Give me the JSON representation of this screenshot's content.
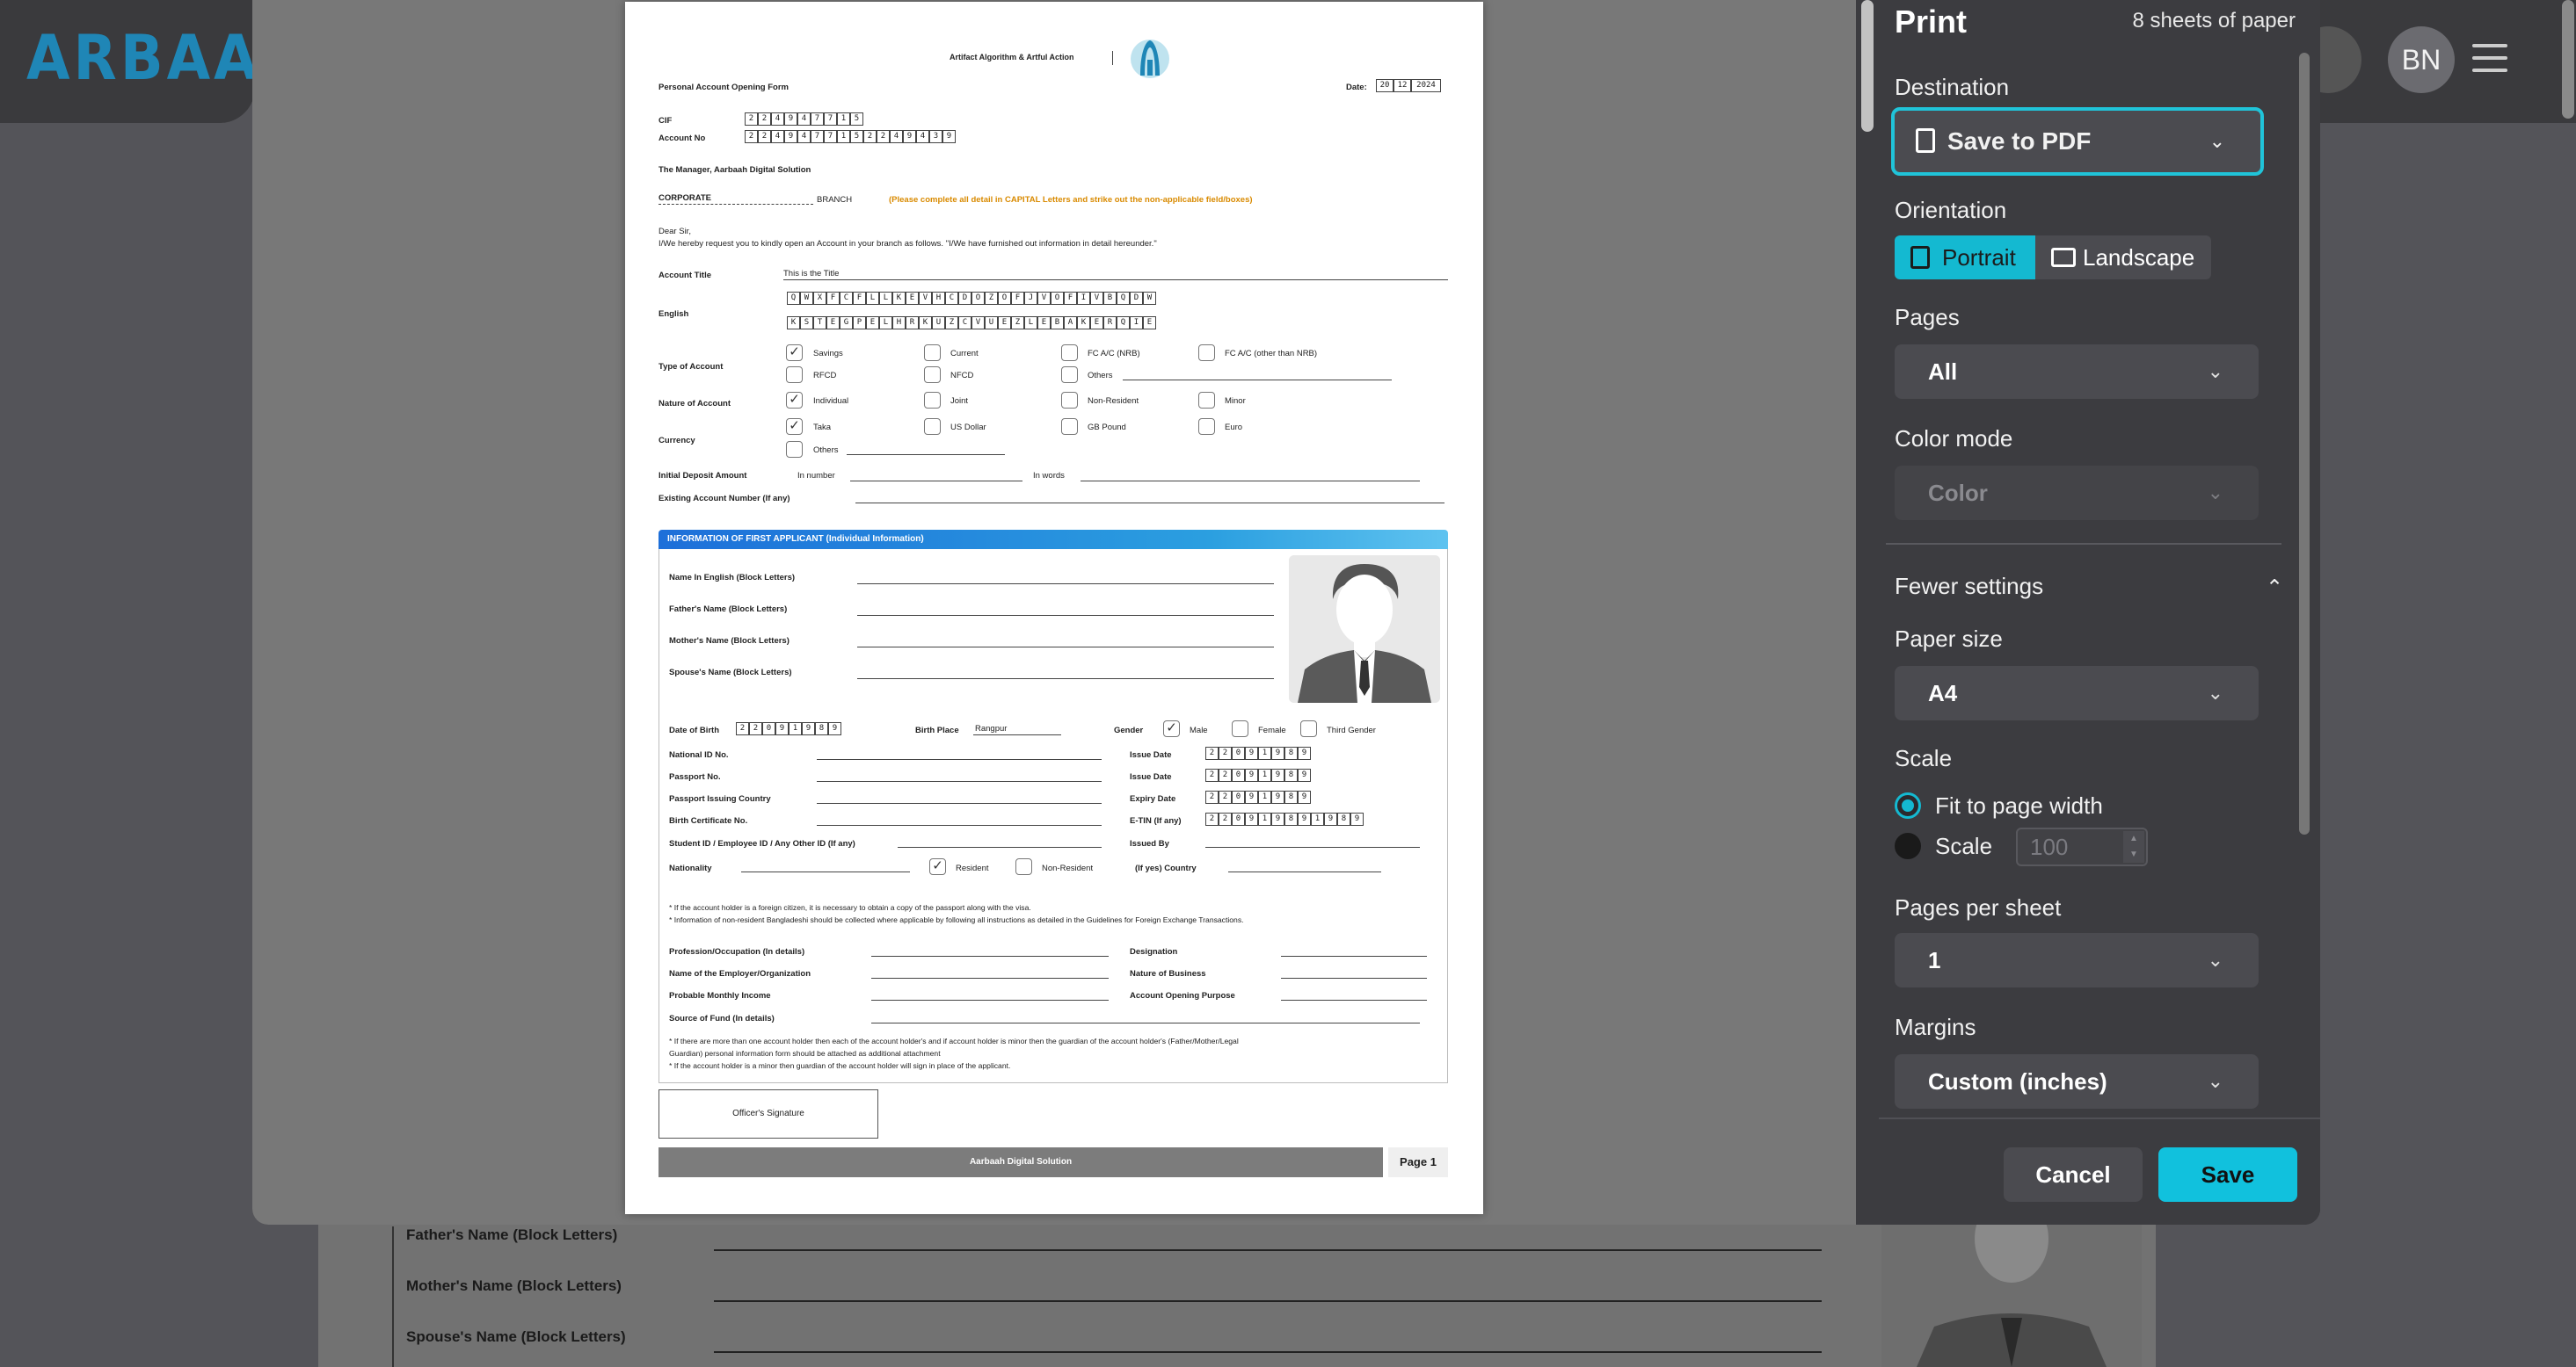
{
  "background": {
    "logo_text": "ARBAAH",
    "avatar_initials": "BN",
    "form_labels": [
      "Father's Name (Block Letters)",
      "Mother's Name (Block Letters)",
      "Spouse's Name (Block Letters)"
    ]
  },
  "preview": {
    "header_org": "Artifact Algorithm & Artful Action",
    "form_title": "Personal Account Opening Form",
    "date_label": "Date:",
    "date_values": [
      "20",
      "12",
      "2024"
    ],
    "cif_label": "CIF",
    "cif_digits": [
      "2",
      "2",
      "4",
      "9",
      "4",
      "7",
      "7",
      "1",
      "5"
    ],
    "account_no_label": "Account No",
    "account_no_digits": [
      "2",
      "2",
      "4",
      "9",
      "4",
      "7",
      "7",
      "1",
      "5",
      "2",
      "2",
      "4",
      "9",
      "4",
      "3",
      "9"
    ],
    "manager_line": "The Manager, Aarbaah Digital Solution",
    "branch_value": "CORPORATE",
    "branch_label": "BRANCH",
    "instruction": "(Please complete all detail in CAPITAL Letters and strike out the non-applicable field/boxes)",
    "dear_sir": "Dear Sir,",
    "request_text": "I/We hereby request you to kindly open an Account in your branch as follows. \"I/We have furnished out information in detail hereunder.\"",
    "account_title_label": "Account Title",
    "account_title_value": "This is the Title",
    "english_label": "English",
    "english_row1": [
      "Q",
      "W",
      "X",
      "F",
      "C",
      "F",
      "L",
      "L",
      "K",
      "E",
      "V",
      "H",
      "C",
      "D",
      "O",
      "Z",
      "O",
      "F",
      "J",
      "V",
      "O",
      "F",
      "I",
      "V",
      "B",
      "Q",
      "D",
      "W"
    ],
    "english_row2": [
      "K",
      "S",
      "T",
      "E",
      "G",
      "P",
      "E",
      "L",
      "H",
      "R",
      "K",
      "U",
      "Z",
      "C",
      "V",
      "U",
      "E",
      "Z",
      "L",
      "E",
      "B",
      "A",
      "K",
      "E",
      "R",
      "Q",
      "I",
      "E"
    ],
    "type_label": "Type of Account",
    "type_options": [
      "Savings",
      "Current",
      "FC A/C (NRB)",
      "FC A/C (other than NRB)",
      "RFCD",
      "NFCD",
      "Others"
    ],
    "nature_label": "Nature of Account",
    "nature_options": [
      "Individual",
      "Joint",
      "Non-Resident",
      "Minor"
    ],
    "currency_label": "Currency",
    "currency_options": [
      "Taka",
      "US Dollar",
      "GB Pound",
      "Euro",
      "Others"
    ],
    "deposit_label": "Initial Deposit Amount",
    "in_number": "In number",
    "in_words": "In words",
    "existing_label": "Existing Account Number (If any)",
    "section_title": "INFORMATION OF FIRST APPLICANT (Individual Information)",
    "name_labels": [
      "Name In English (Block Letters)",
      "Father's Name (Block Letters)",
      "Mother's Name (Block Letters)",
      "Spouse's Name (Block Letters)"
    ],
    "dob_label": "Date of Birth",
    "dob_digits": [
      "2",
      "2",
      "0",
      "9",
      "1",
      "9",
      "8",
      "9"
    ],
    "birth_place_label": "Birth Place",
    "birth_place_value": "Rangpur",
    "gender_label": "Gender",
    "gender_options": [
      "Male",
      "Female",
      "Third Gender"
    ],
    "id_labels": [
      "National ID No.",
      "Passport No.",
      "Passport Issuing Country",
      "Birth Certificate No.",
      "Student ID / Employee ID / Any Other ID (If any)"
    ],
    "date_labels": [
      "Issue Date",
      "Issue Date",
      "Expiry Date",
      "E-TIN (If any)",
      "Issued By"
    ],
    "date_digits": [
      "2",
      "2",
      "0",
      "9",
      "1",
      "9",
      "8",
      "9"
    ],
    "etin_digits": [
      "2",
      "2",
      "0",
      "9",
      "1",
      "9",
      "8",
      "9",
      "1",
      "9",
      "8",
      "9"
    ],
    "nationality_label": "Nationality",
    "resident_label": "Resident",
    "non_resident_label": "Non-Resident",
    "if_yes_label": "(If yes) Country",
    "note1": "* If the account holder is a foreign citizen, it is necessary to obtain a copy of the passport along with the visa.",
    "note2": "* Information of non-resident Bangladeshi should be collected where applicable by following all instructions as detailed in the Guidelines for Foreign Exchange Transactions.",
    "occupation_labels": [
      "Profession/Occupation (In details)",
      "Name of the Employer/Organization",
      "Probable Monthly Income",
      "Source of Fund (In details)"
    ],
    "right_labels": [
      "Designation",
      "Nature of Business",
      "Account Opening Purpose"
    ],
    "note3": "* If there are more than one account holder then each of the account holder's and if account holder is minor then the guardian of the account holder's (Father/Mother/Legal",
    "note3b": "Guardian) personal information form should be attached as additional attachment",
    "note4": "* If the account holder is a minor then guardian of the account holder will sign in place of the applicant.",
    "officer_signature": "Officer's Signature",
    "footer_company": "Aarbaah Digital Solution",
    "page_label": "Page 1"
  },
  "print": {
    "title": "Print",
    "sheets": "8 sheets of paper",
    "destination_label": "Destination",
    "destination_value": "Save to PDF",
    "orientation_label": "Orientation",
    "portrait": "Portrait",
    "landscape": "Landscape",
    "pages_label": "Pages",
    "pages_value": "All",
    "color_label": "Color mode",
    "color_value": "Color",
    "fewer_settings": "Fewer settings",
    "paper_label": "Paper size",
    "paper_value": "A4",
    "scale_label": "Scale",
    "fit_label": "Fit to page width",
    "scale_option": "Scale",
    "scale_value": "100",
    "pps_label": "Pages per sheet",
    "pps_value": "1",
    "margins_label": "Margins",
    "margins_value": "Custom (inches)",
    "cancel": "Cancel",
    "save": "Save",
    "accent_color": "#14b9d1"
  }
}
